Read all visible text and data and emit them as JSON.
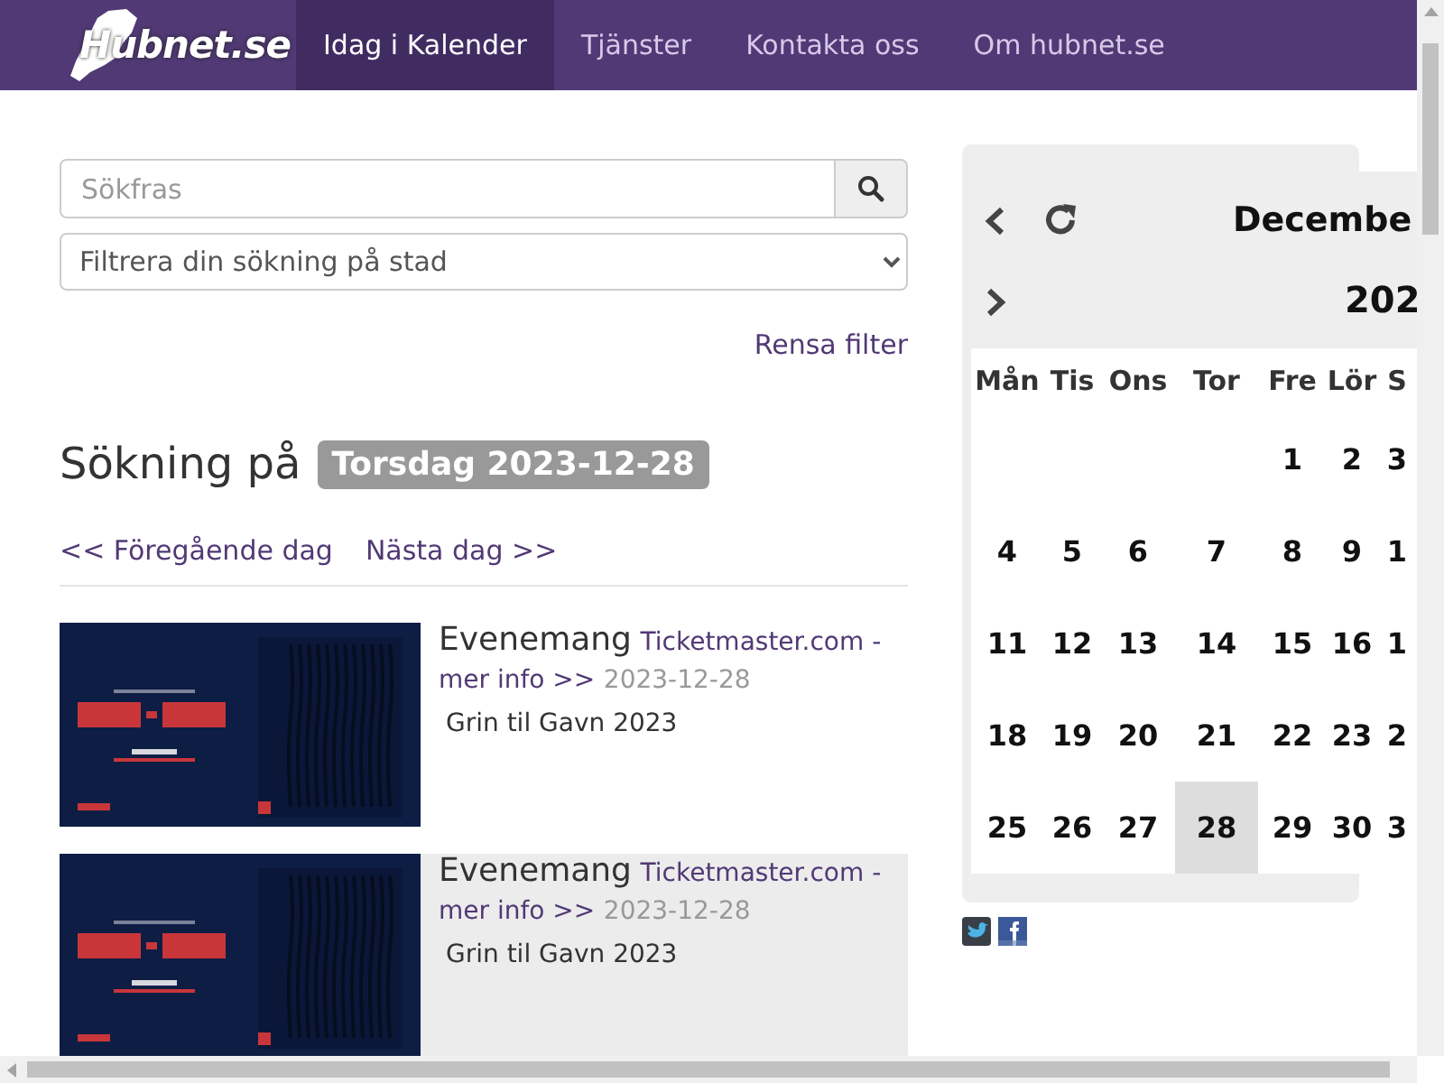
{
  "nav": {
    "logo": "Hubnet.se",
    "items": [
      {
        "label": "Idag i Kalender",
        "selected": true
      },
      {
        "label": "Tjänster",
        "selected": false
      },
      {
        "label": "Kontakta oss",
        "selected": false
      },
      {
        "label": "Om hubnet.se",
        "selected": false
      }
    ]
  },
  "search": {
    "placeholder": "Sökfras",
    "filter": "Filtrera din sökning på stad",
    "clear": "Rensa filter"
  },
  "heading": {
    "text": "Sökning på",
    "badge": "Torsdag 2023-12-28"
  },
  "day_nav": {
    "previous": "<< Föregående dag",
    "next": "Nästa dag >>"
  },
  "events": [
    {
      "kind": "picture",
      "title": "Evenemang",
      "link": "Ticketmaster.com - mer info >>",
      "date": "2023-12-28",
      "description": "Grin til Gavn 2023",
      "highlighted": false
    },
    {
      "kind": "picture",
      "title": "Evenemang",
      "link": "Ticketmaster.com - mer info >>",
      "date": "2023-12-28",
      "description": "Grin til Gavn 2023",
      "highlighted": true
    }
  ],
  "calendar": {
    "month": "Decembe",
    "year": "202",
    "weekdays": [
      "Mån",
      "Tis",
      "Ons",
      "Tor",
      "Fre",
      "Lör",
      "S"
    ],
    "weeks": [
      [
        {
          "kind": "blank"
        },
        {
          "kind": "blank"
        },
        {
          "kind": "blank"
        },
        {
          "kind": "blank"
        },
        {
          "kind": "day",
          "day": "1",
          "selected": false
        },
        {
          "kind": "day",
          "day": "2",
          "selected": false
        },
        {
          "kind": "day",
          "day": "3",
          "selected": false
        }
      ],
      [
        {
          "kind": "day",
          "day": "4",
          "selected": false
        },
        {
          "kind": "day",
          "day": "5",
          "selected": false
        },
        {
          "kind": "day",
          "day": "6",
          "selected": false
        },
        {
          "kind": "day",
          "day": "7",
          "selected": false
        },
        {
          "kind": "day",
          "day": "8",
          "selected": false
        },
        {
          "kind": "day",
          "day": "9",
          "selected": false
        },
        {
          "kind": "day",
          "day": "1",
          "selected": false
        }
      ],
      [
        {
          "kind": "day",
          "day": "11",
          "selected": false
        },
        {
          "kind": "day",
          "day": "12",
          "selected": false
        },
        {
          "kind": "day",
          "day": "13",
          "selected": false
        },
        {
          "kind": "day",
          "day": "14",
          "selected": false
        },
        {
          "kind": "day",
          "day": "15",
          "selected": false
        },
        {
          "kind": "day",
          "day": "16",
          "selected": false
        },
        {
          "kind": "day",
          "day": "1",
          "selected": false
        }
      ],
      [
        {
          "kind": "day",
          "day": "18",
          "selected": false
        },
        {
          "kind": "day",
          "day": "19",
          "selected": false
        },
        {
          "kind": "day",
          "day": "20",
          "selected": false
        },
        {
          "kind": "day",
          "day": "21",
          "selected": false
        },
        {
          "kind": "day",
          "day": "22",
          "selected": false
        },
        {
          "kind": "day",
          "day": "23",
          "selected": false
        },
        {
          "kind": "day",
          "day": "2",
          "selected": false
        }
      ],
      [
        {
          "kind": "day",
          "day": "25",
          "selected": false
        },
        {
          "kind": "day",
          "day": "26",
          "selected": false
        },
        {
          "kind": "day",
          "day": "27",
          "selected": false
        },
        {
          "kind": "day",
          "day": "28",
          "selected": true
        },
        {
          "kind": "day",
          "day": "29",
          "selected": false
        },
        {
          "kind": "day",
          "day": "30",
          "selected": false
        },
        {
          "kind": "day",
          "day": "3",
          "selected": false
        }
      ]
    ]
  }
}
